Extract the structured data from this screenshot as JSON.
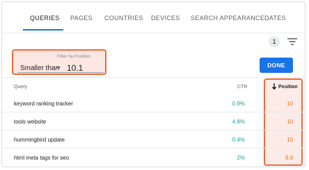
{
  "tabs": [
    {
      "label": "QUERIES",
      "active": true
    },
    {
      "label": "PAGES",
      "active": false
    },
    {
      "label": "COUNTRIES",
      "active": false
    },
    {
      "label": "DEVICES",
      "active": false
    },
    {
      "label": "SEARCH APPEARANCE",
      "active": false
    },
    {
      "label": "DATES",
      "active": false
    }
  ],
  "filter_count": "1",
  "filter": {
    "floating_label": "Filter by Position",
    "operator": "Smaller than",
    "value": "10.1"
  },
  "done_label": "DONE",
  "table": {
    "headers": {
      "query": "Query",
      "ctr": "CTR",
      "position": "Position"
    },
    "rows": [
      {
        "query": "keyword ranking tracker",
        "ctr": "0.9%",
        "position": "10"
      },
      {
        "query": "tools website",
        "ctr": "4.8%",
        "position": "10"
      },
      {
        "query": "hummingbird update",
        "ctr": "0.4%",
        "position": "10"
      },
      {
        "query": "html meta tags for seo",
        "ctr": "2%",
        "position": "9.9"
      }
    ]
  },
  "colors": {
    "accent": "#1a73e8",
    "highlight_border": "#ee6a3a",
    "highlight_fill": "#fde7e3",
    "ctr": "#12a4a4",
    "position": "#e8711a"
  },
  "icons": {
    "filter": "filter-list-icon",
    "sort": "arrow-down-icon",
    "dropdown": "caret-down-icon"
  }
}
